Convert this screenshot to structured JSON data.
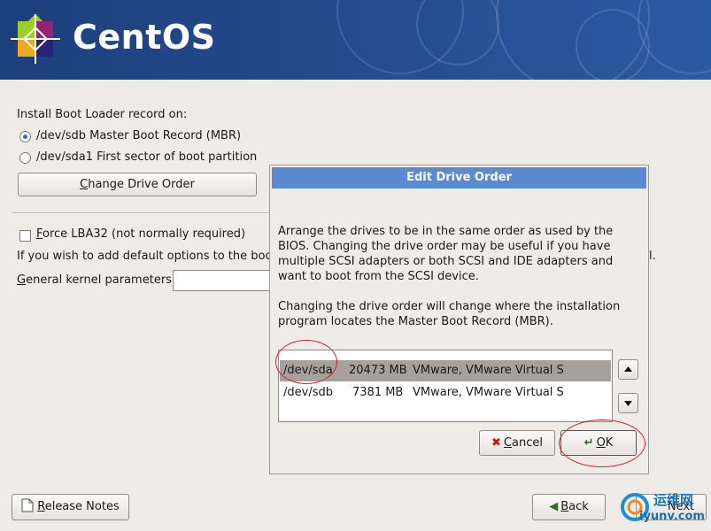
{
  "banner": {
    "logo_text": "CentOS"
  },
  "boot_loader": {
    "heading": "Install Boot Loader record on:",
    "options": [
      {
        "label": "/dev/sdb Master Boot Record (MBR)",
        "selected": true
      },
      {
        "label": "/dev/sda1 First sector of boot partition",
        "selected": false
      }
    ],
    "change_drive_order_prefix": "",
    "change_drive_order_ul": "C",
    "change_drive_order_rest": "hange Drive Order"
  },
  "options": {
    "force_lba_ul": "F",
    "force_lba_rest": "orce LBA32 (not normally required)",
    "force_lba_checked": false,
    "kernel_hint": "If you wish to add default options to the boo",
    "kernel_hint_tail": "l.",
    "kernel_label_ul": "G",
    "kernel_label_rest": "eneral kernel parameters",
    "kernel_value": ""
  },
  "dialog": {
    "title": "Edit Drive Order",
    "paragraph1": "Arrange the drives to be in the same order as used by the BIOS. Changing the drive order may be useful if you have multiple SCSI adapters or both SCSI and IDE adapters and want to boot from the SCSI device.",
    "paragraph2": "Changing the drive order will change where the installation program locates the Master Boot Record (MBR).",
    "drives": [
      {
        "device": "/dev/sda",
        "size": "20473 MB",
        "model": "VMware, VMware Virtual S",
        "selected": true
      },
      {
        "device": "/dev/sdb",
        "size": "7381 MB",
        "model": "VMware, VMware Virtual S",
        "selected": false
      }
    ],
    "cancel_ul": "C",
    "cancel_rest": "ancel",
    "ok_ul": "O",
    "ok_rest": "K"
  },
  "footer": {
    "release_notes_ul": "R",
    "release_notes_rest": "elease Notes",
    "back_ul": "B",
    "back_rest": "ack",
    "next_label": "Next"
  },
  "watermark": {
    "text_cn": "运维网",
    "text_url": "iyunv.com"
  },
  "colors": {
    "banner": "#244a8c",
    "dialog_title": "#5a8ad0",
    "annotation": "#d1242c",
    "selection": "#a6a19a"
  }
}
